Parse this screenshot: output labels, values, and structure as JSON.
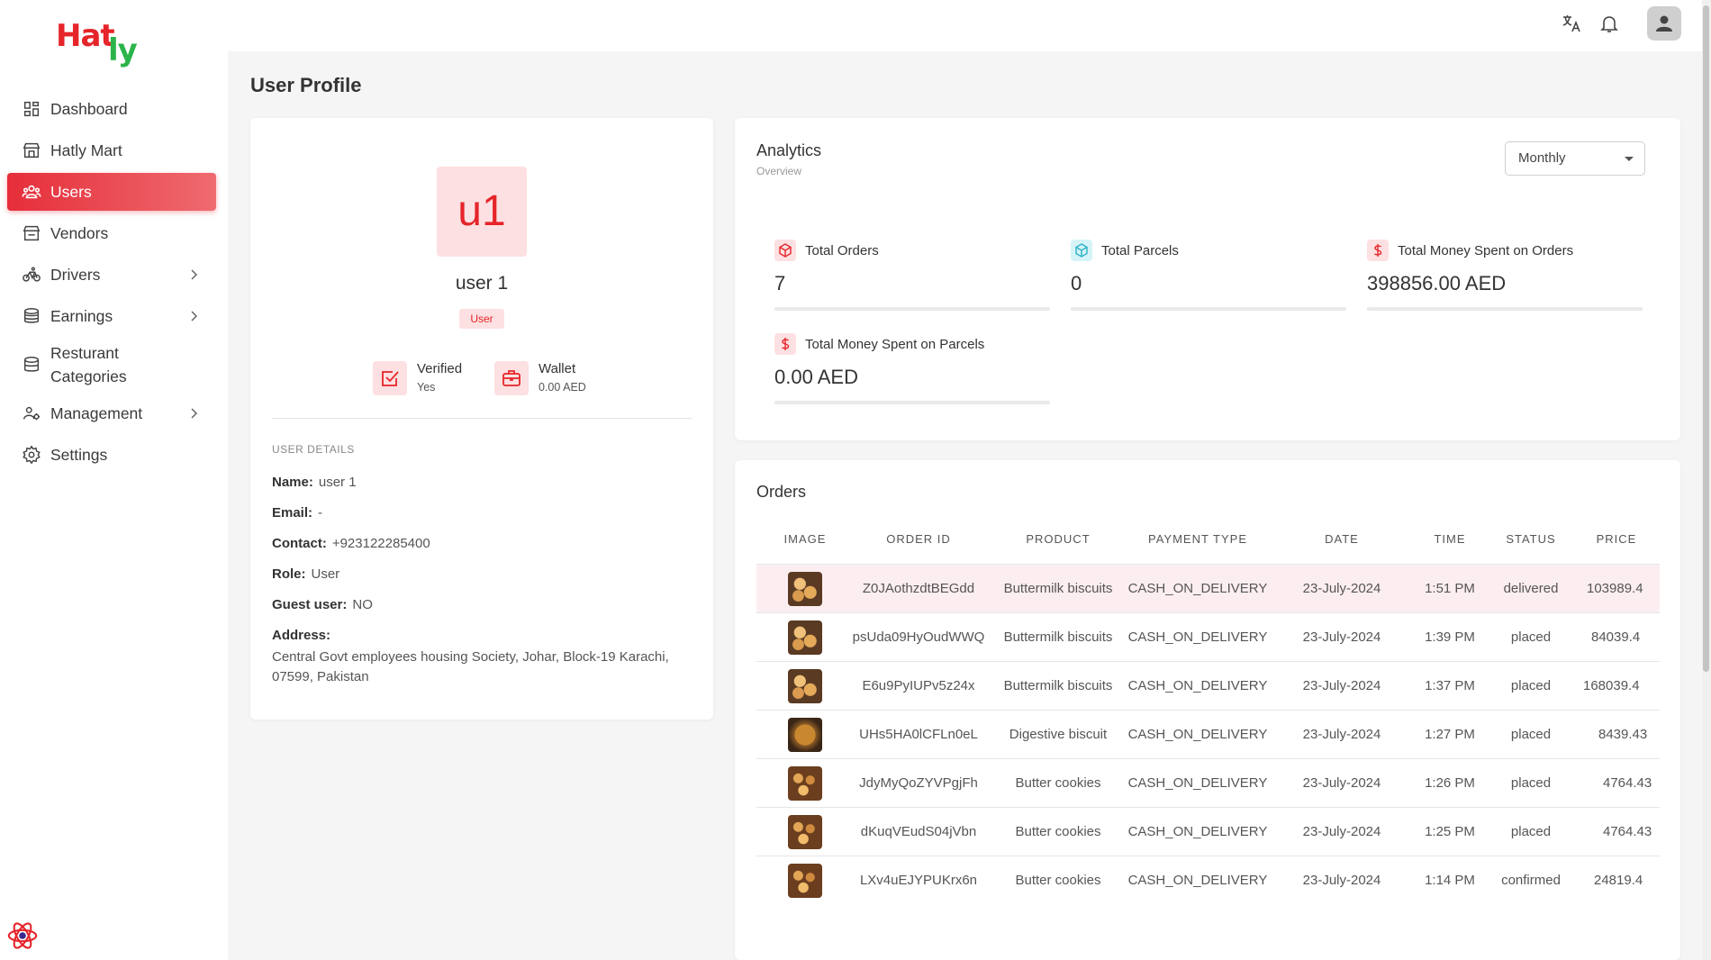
{
  "brand": {
    "logo_part1": "Hat",
    "logo_part2": "ly"
  },
  "sidebar": {
    "items": [
      {
        "label": "Dashboard"
      },
      {
        "label": "Hatly Mart"
      },
      {
        "label": "Users"
      },
      {
        "label": "Vendors"
      },
      {
        "label": "Drivers"
      },
      {
        "label": "Earnings"
      },
      {
        "label": "Resturant Categories"
      },
      {
        "label": "Management"
      },
      {
        "label": "Settings"
      }
    ]
  },
  "page": {
    "title": "User Profile"
  },
  "profile": {
    "initials": "u1",
    "name": "user 1",
    "role_badge": "User",
    "verified_label": "Verified",
    "verified_value": "Yes",
    "wallet_label": "Wallet",
    "wallet_value": "0.00 AED",
    "section_title": "USER DETAILS",
    "details": {
      "name_label": "Name:",
      "name_value": "user 1",
      "email_label": "Email:",
      "email_value": "-",
      "contact_label": "Contact:",
      "contact_value": "+923122285400",
      "role_label": "Role:",
      "role_value": "User",
      "guest_label": "Guest user:",
      "guest_value": "NO",
      "address_label": "Address:",
      "address_value": "Central Govt employees housing Society, Johar, Block-19 Karachi, 07599, Pakistan"
    }
  },
  "analytics": {
    "title": "Analytics",
    "subtitle": "Overview",
    "period": "Monthly",
    "metrics": [
      {
        "label": "Total Orders",
        "value": "7"
      },
      {
        "label": "Total Parcels",
        "value": "0"
      },
      {
        "label": "Total Money Spent on Orders",
        "value": "398856.00 AED"
      },
      {
        "label": "Total Money Spent on Parcels",
        "value": "0.00 AED"
      }
    ]
  },
  "orders": {
    "title": "Orders",
    "columns": [
      "IMAGE",
      "ORDER ID",
      "PRODUCT",
      "PAYMENT TYPE",
      "DATE",
      "TIME",
      "STATUS",
      "PRICE"
    ],
    "rows": [
      {
        "order_id": "Z0JAothzdtBEGdd",
        "product": "Buttermilk biscuits",
        "payment": "CASH_ON_DELIVERY",
        "date": "23-July-2024",
        "time": "1:51 PM",
        "status": "delivered",
        "price": "103989.4"
      },
      {
        "order_id": "psUda09HyOudWWQ",
        "product": "Buttermilk biscuits",
        "payment": "CASH_ON_DELIVERY",
        "date": "23-July-2024",
        "time": "1:39 PM",
        "status": "placed",
        "price": "84039.4"
      },
      {
        "order_id": "E6u9PyIUPv5z24x",
        "product": "Buttermilk biscuits",
        "payment": "CASH_ON_DELIVERY",
        "date": "23-July-2024",
        "time": "1:37 PM",
        "status": "placed",
        "price": "168039.4"
      },
      {
        "order_id": "UHs5HA0lCFLn0eL",
        "product": "Digestive biscuit",
        "payment": "CASH_ON_DELIVERY",
        "date": "23-July-2024",
        "time": "1:27 PM",
        "status": "placed",
        "price": "8439.43"
      },
      {
        "order_id": "JdyMyQoZYVPgjFh",
        "product": "Butter cookies",
        "payment": "CASH_ON_DELIVERY",
        "date": "23-July-2024",
        "time": "1:26 PM",
        "status": "placed",
        "price": "4764.43"
      },
      {
        "order_id": "dKuqVEudS04jVbn",
        "product": "Butter cookies",
        "payment": "CASH_ON_DELIVERY",
        "date": "23-July-2024",
        "time": "1:25 PM",
        "status": "placed",
        "price": "4764.43"
      },
      {
        "order_id": "LXv4uEJYPUKrx6n",
        "product": "Butter cookies",
        "payment": "CASH_ON_DELIVERY",
        "date": "23-July-2024",
        "time": "1:14 PM",
        "status": "confirmed",
        "price": "24819.4"
      }
    ]
  },
  "colors": {
    "accent": "#e5252a",
    "accent_soft": "#fde0e1",
    "parcel_icon": "#2bb3c9"
  },
  "icons": {
    "topbar": [
      "translate-icon",
      "bell-icon",
      "user-avatar-icon"
    ],
    "footer": "react-logo-icon"
  }
}
